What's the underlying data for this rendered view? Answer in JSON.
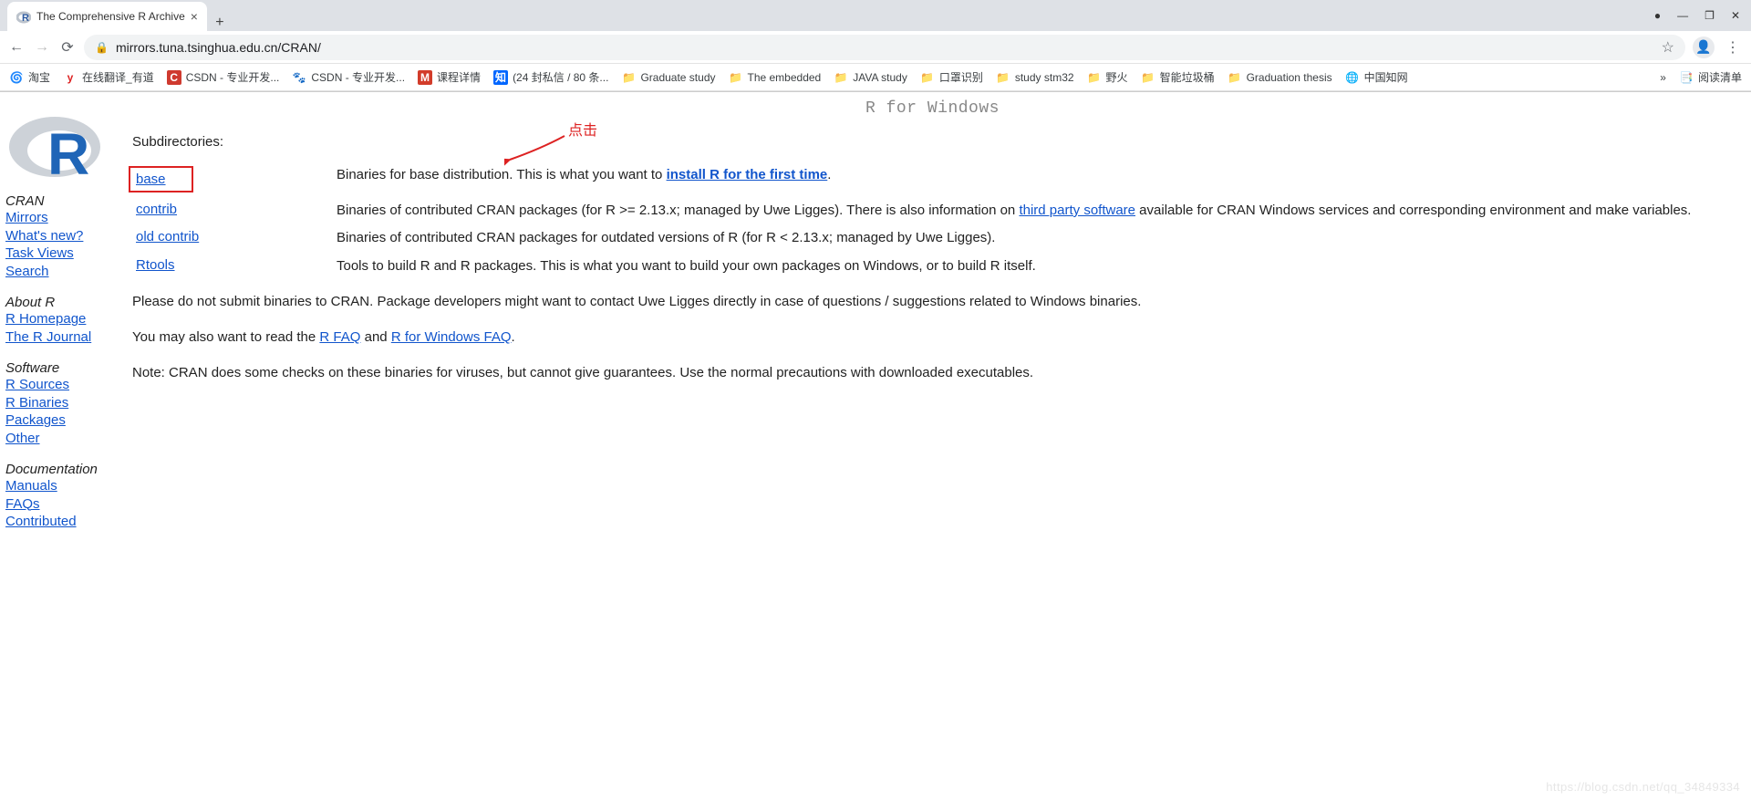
{
  "browser": {
    "tab_title": "The Comprehensive R Archive",
    "url": "mirrors.tuna.tsinghua.edu.cn/CRAN/"
  },
  "bookmarks": [
    {
      "label": "淘宝",
      "icon": "taobao"
    },
    {
      "label": "在线翻译_有道",
      "icon": "youdao"
    },
    {
      "label": "CSDN - 专业开发...",
      "icon": "csdn"
    },
    {
      "label": "CSDN - 专业开发...",
      "icon": "paw"
    },
    {
      "label": "课程详情",
      "icon": "mooc"
    },
    {
      "label": "(24 封私信 / 80 条...",
      "icon": "zhi"
    },
    {
      "label": "Graduate study",
      "icon": "folder"
    },
    {
      "label": "The embedded",
      "icon": "folder"
    },
    {
      "label": "JAVA study",
      "icon": "folder"
    },
    {
      "label": "口罩识别",
      "icon": "folder"
    },
    {
      "label": "study stm32",
      "icon": "folder"
    },
    {
      "label": "野火",
      "icon": "folder"
    },
    {
      "label": "智能垃圾桶",
      "icon": "folder"
    },
    {
      "label": "Graduation thesis",
      "icon": "folder"
    },
    {
      "label": "中国知网",
      "icon": "globe"
    }
  ],
  "bookmarks_right": {
    "overflow": "»",
    "reading_list": "阅读清单"
  },
  "annotation": {
    "label": "点击"
  },
  "page": {
    "title": "R for Windows",
    "sidebar": {
      "groups": [
        {
          "head": "CRAN",
          "links": [
            "Mirrors",
            "What's new?",
            "Task Views",
            "Search"
          ]
        },
        {
          "head": "About R",
          "links": [
            "R Homepage",
            "The R Journal"
          ]
        },
        {
          "head": "Software",
          "links": [
            "R Sources",
            "R Binaries",
            "Packages",
            "Other"
          ]
        },
        {
          "head": "Documentation",
          "links": [
            "Manuals",
            "FAQs",
            "Contributed"
          ]
        }
      ]
    },
    "subdir_label": "Subdirectories:",
    "subdirs": [
      {
        "name": "base",
        "boxed": true,
        "desc_pre": "Binaries for base distribution. This is what you want to ",
        "link_text": "install R for the first time",
        "link_bold": true,
        "desc_post": "."
      },
      {
        "name": "contrib",
        "desc_pre": "Binaries of contributed CRAN packages (for R >= 2.13.x; managed by Uwe Ligges). There is also information on ",
        "link_text": "third party software",
        "desc_post": " available for CRAN Windows services and corresponding environment and make variables."
      },
      {
        "name": "old contrib",
        "desc_pre": "Binaries of contributed CRAN packages for outdated versions of R (for R < 2.13.x; managed by Uwe Ligges).",
        "link_text": "",
        "desc_post": ""
      },
      {
        "name": "Rtools",
        "desc_pre": "Tools to build R and R packages. This is what you want to build your own packages on Windows, or to build R itself.",
        "link_text": "",
        "desc_post": ""
      }
    ],
    "para1": "Please do not submit binaries to CRAN. Package developers might want to contact Uwe Ligges directly in case of questions / suggestions related to Windows binaries.",
    "para2_pre": "You may also want to read the ",
    "para2_link1": "R FAQ",
    "para2_mid": " and ",
    "para2_link2": "R for Windows FAQ",
    "para2_post": ".",
    "para3": "Note: CRAN does some checks on these binaries for viruses, but cannot give guarantees. Use the normal precautions with downloaded executables."
  },
  "watermark": "https://blog.csdn.net/qq_34849334"
}
